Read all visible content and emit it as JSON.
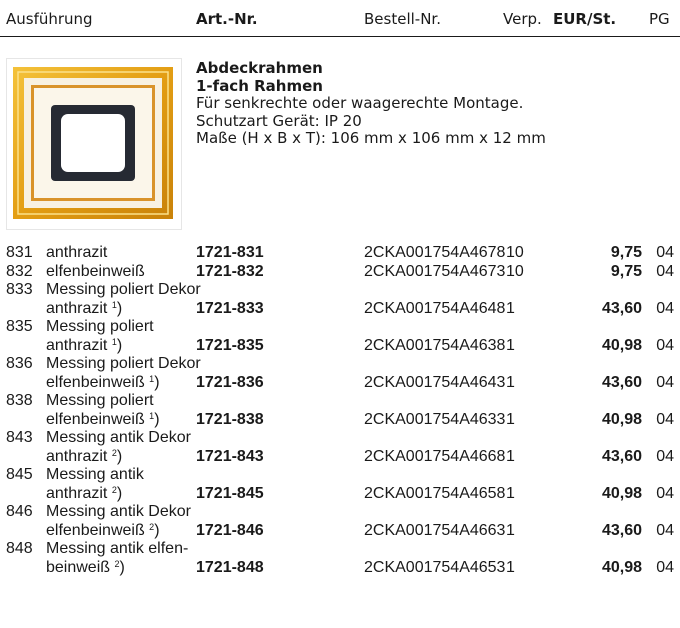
{
  "header": {
    "ausfuehrung": "Ausführung",
    "art_nr": "Art.-Nr.",
    "bestell_nr": "Bestell-Nr.",
    "verp": "Verp.",
    "eur": "EUR/St.",
    "pg": "PG"
  },
  "product": {
    "title1": "Abdeckrahmen",
    "title2": "1-fach Rahmen",
    "line1": "Für senkrechte oder waagerechte Montage.",
    "line2": "Schutzart Gerät: IP 20",
    "line3": "Maße (H x B x T): 106 mm x 106 mm x 12 mm"
  },
  "rows": [
    {
      "code": "831",
      "desc": [
        "anthrazit"
      ],
      "note": "",
      "art": "1721-831",
      "best": "2CKA001754A4678",
      "verp": "10",
      "eur": "9,75",
      "pg": "04"
    },
    {
      "code": "832",
      "desc": [
        "elfenbeinweiß"
      ],
      "note": "",
      "art": "1721-832",
      "best": "2CKA001754A4673",
      "verp": "10",
      "eur": "9,75",
      "pg": "04"
    },
    {
      "code": "833",
      "desc": [
        "Messing poliert Dekor",
        "anthrazit "
      ],
      "note": "1",
      "art": "1721-833",
      "best": "2CKA001754A4648",
      "verp": "1",
      "eur": "43,60",
      "pg": "04"
    },
    {
      "code": "835",
      "desc": [
        "Messing poliert",
        "anthrazit "
      ],
      "note": "1",
      "art": "1721-835",
      "best": "2CKA001754A4638",
      "verp": "1",
      "eur": "40,98",
      "pg": "04"
    },
    {
      "code": "836",
      "desc": [
        "Messing poliert Dekor",
        "elfenbeinweiß "
      ],
      "note": "1",
      "art": "1721-836",
      "best": "2CKA001754A4643",
      "verp": "1",
      "eur": "43,60",
      "pg": "04"
    },
    {
      "code": "838",
      "desc": [
        "Messing poliert",
        "elfenbeinweiß "
      ],
      "note": "1",
      "art": "1721-838",
      "best": "2CKA001754A4633",
      "verp": "1",
      "eur": "40,98",
      "pg": "04"
    },
    {
      "code": "843",
      "desc": [
        "Messing antik Dekor",
        "anthrazit "
      ],
      "note": "2",
      "art": "1721-843",
      "best": "2CKA001754A4668",
      "verp": "1",
      "eur": "43,60",
      "pg": "04"
    },
    {
      "code": "845",
      "desc": [
        "Messing antik",
        "anthrazit "
      ],
      "note": "2",
      "art": "1721-845",
      "best": "2CKA001754A4658",
      "verp": "1",
      "eur": "40,98",
      "pg": "04"
    },
    {
      "code": "846",
      "desc": [
        "Messing antik Dekor",
        "elfenbeinweiß "
      ],
      "note": "2",
      "art": "1721-846",
      "best": "2CKA001754A4663",
      "verp": "1",
      "eur": "43,60",
      "pg": "04"
    },
    {
      "code": "848",
      "desc": [
        "Messing antik elfen-",
        "beinweiß "
      ],
      "note": "2",
      "art": "1721-848",
      "best": "2CKA001754A4653",
      "verp": "1",
      "eur": "40,98",
      "pg": "04"
    }
  ]
}
